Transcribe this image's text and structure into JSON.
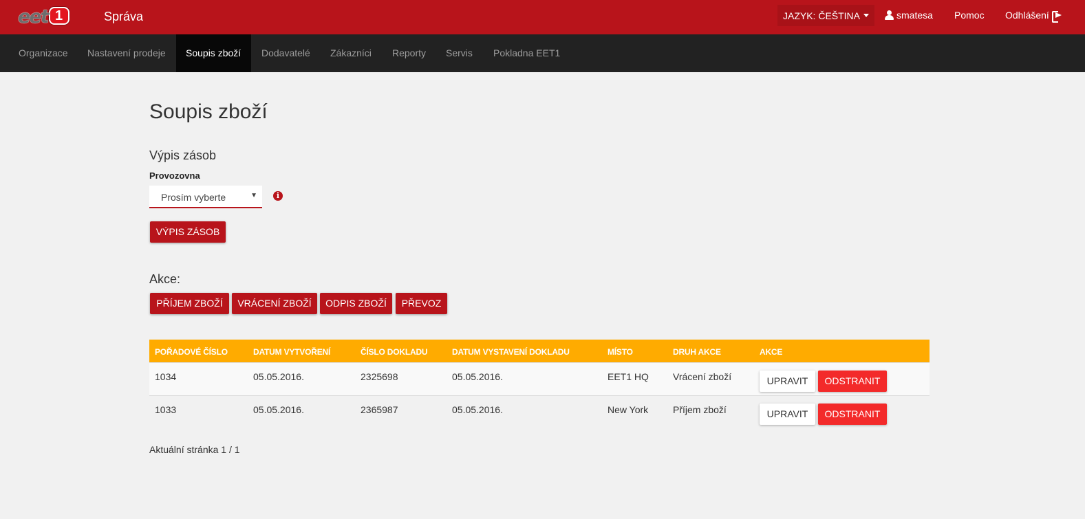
{
  "header": {
    "app_title": "Správa",
    "logo": {
      "text": "eet",
      "badge": "1"
    },
    "language_label": "JAZYK: ČEŠTINA",
    "username": "smatesa",
    "help_label": "Pomoc",
    "logout_label": "Odhlášení"
  },
  "nav": {
    "items": [
      {
        "label": "Organizace"
      },
      {
        "label": "Nastavení prodeje"
      },
      {
        "label": "Soupis zboží"
      },
      {
        "label": "Dodavatelé"
      },
      {
        "label": "Zákazníci"
      },
      {
        "label": "Reporty"
      },
      {
        "label": "Servis"
      },
      {
        "label": "Pokladna EET1"
      }
    ],
    "active": "Soupis zboží"
  },
  "main": {
    "page_title": "Soupis zboží",
    "stock_section_title": "Výpis zásob",
    "location_label": "Provozovna",
    "location_select_value": "Prosím vyberte",
    "stock_button_label": "VÝPIS ZÁSOB",
    "actions_label": "Akce:",
    "action_buttons": [
      {
        "label": "PŘÍJEM ZBOŽÍ"
      },
      {
        "label": "VRÁCENÍ ZBOŽÍ"
      },
      {
        "label": "ODPIS ZBOŽÍ"
      },
      {
        "label": "PŘEVOZ"
      }
    ]
  },
  "table": {
    "columns": [
      "POŘADOVÉ ČÍSLO",
      "DATUM VYTVOŘENÍ",
      "ČÍSLO DOKLADU",
      "DATUM VYSTAVENÍ DOKLADU",
      "MÍSTO",
      "DRUH AKCE",
      "AKCE"
    ],
    "rows": [
      {
        "number": "1034",
        "created": "05.05.2016.",
        "doc_number": "2325698",
        "doc_date": "05.05.2016.",
        "place": "EET1 HQ",
        "action_type": "Vrácení zboží",
        "edit_label": "UPRAVIT",
        "delete_label": "ODSTRANIT"
      },
      {
        "number": "1033",
        "created": "05.05.2016.",
        "doc_number": "2365987",
        "doc_date": "05.05.2016.",
        "place": "New York",
        "action_type": "Příjem zboží",
        "edit_label": "UPRAVIT",
        "delete_label": "ODSTRANIT"
      }
    ]
  },
  "pagination": {
    "text": "Aktuální stránka 1 / 1"
  },
  "colors": {
    "brand_red": "#b8141b",
    "nav_dark": "#222222",
    "table_header": "#ffab00",
    "delete_red": "#f32a2a"
  },
  "icons": [
    "user-icon",
    "logout-icon",
    "info-icon",
    "chevron-down-icon"
  ]
}
